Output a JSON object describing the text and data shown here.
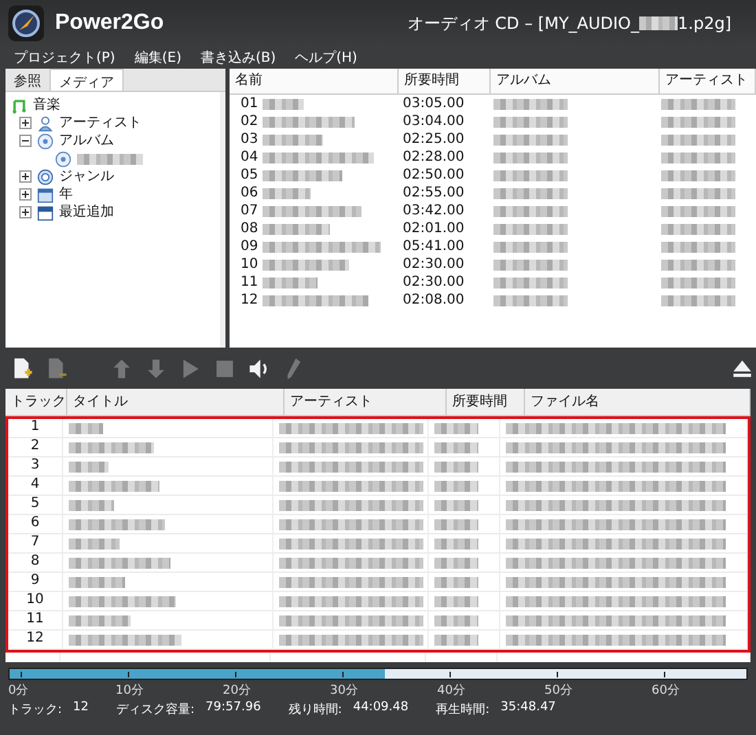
{
  "window": {
    "app_name": "Power2Go",
    "title_start": "オーディオ CD – [MY_AUDIO_",
    "title_end": "1.p2g]"
  },
  "menu": [
    "プロジェクト(P)",
    "編集(E)",
    "書き込み(B)",
    "ヘルプ(H)"
  ],
  "tabs": [
    {
      "label": "参照",
      "selected": false
    },
    {
      "label": "メディア",
      "selected": true
    }
  ],
  "tree": [
    {
      "kind": "music",
      "label": "音楽",
      "children": [
        {
          "kind": "person",
          "label": "アーティスト",
          "expanded": false
        },
        {
          "kind": "disc",
          "label": "アルバム",
          "expanded": true,
          "children": [
            {
              "kind": "disc"
            }
          ]
        },
        {
          "kind": "genre",
          "label": "ジャンル",
          "expanded": false
        },
        {
          "kind": "calendar",
          "label": "年",
          "expanded": false
        },
        {
          "kind": "recent",
          "label": "最近追加",
          "expanded": false
        }
      ]
    }
  ],
  "media_list": {
    "columns": [
      "名前",
      "所要時間",
      "アルバム",
      "アーティスト"
    ],
    "rows": [
      {
        "number": "01",
        "duration": "03:05.00"
      },
      {
        "number": "02",
        "duration": "03:04.00"
      },
      {
        "number": "03",
        "duration": "02:25.00"
      },
      {
        "number": "04",
        "duration": "02:28.00"
      },
      {
        "number": "05",
        "duration": "02:50.00"
      },
      {
        "number": "06",
        "duration": "02:55.00"
      },
      {
        "number": "07",
        "duration": "03:42.00"
      },
      {
        "number": "08",
        "duration": "02:01.00"
      },
      {
        "number": "09",
        "duration": "05:41.00"
      },
      {
        "number": "10",
        "duration": "02:30.00"
      },
      {
        "number": "11",
        "duration": "02:30.00"
      },
      {
        "number": "12",
        "duration": "02:08.00"
      }
    ]
  },
  "toolbar": [
    {
      "kind": "add",
      "disabled": false
    },
    {
      "kind": "remove",
      "disabled": true
    },
    {
      "kind": "up",
      "disabled": true
    },
    {
      "kind": "down",
      "disabled": true
    },
    {
      "kind": "play",
      "disabled": true
    },
    {
      "kind": "stop",
      "disabled": true
    },
    {
      "kind": "volume",
      "disabled": false
    },
    {
      "kind": "edit",
      "disabled": true
    }
  ],
  "track_table": {
    "columns": [
      "トラック",
      "タイトル",
      "アーティスト",
      "所要時間",
      "ファイル名"
    ],
    "rows": [
      {
        "track": "1"
      },
      {
        "track": "2"
      },
      {
        "track": "3"
      },
      {
        "track": "4"
      },
      {
        "track": "5"
      },
      {
        "track": "6"
      },
      {
        "track": "7"
      },
      {
        "track": "8"
      },
      {
        "track": "9"
      },
      {
        "track": "10"
      },
      {
        "track": "11"
      },
      {
        "track": "12"
      }
    ]
  },
  "timeline": {
    "level": 0.51,
    "ticks": [
      "0分",
      "10分",
      "20分",
      "30分",
      "40分",
      "50分",
      "60分"
    ]
  },
  "status_bar": [
    {
      "label": "トラック:",
      "value": "12"
    },
    {
      "label": "ディスク容量:",
      "value": "79:57.96"
    },
    {
      "label": "残り時間:",
      "value": "44:09.48"
    },
    {
      "label": "再生時間:",
      "value": "35:48.47"
    }
  ]
}
